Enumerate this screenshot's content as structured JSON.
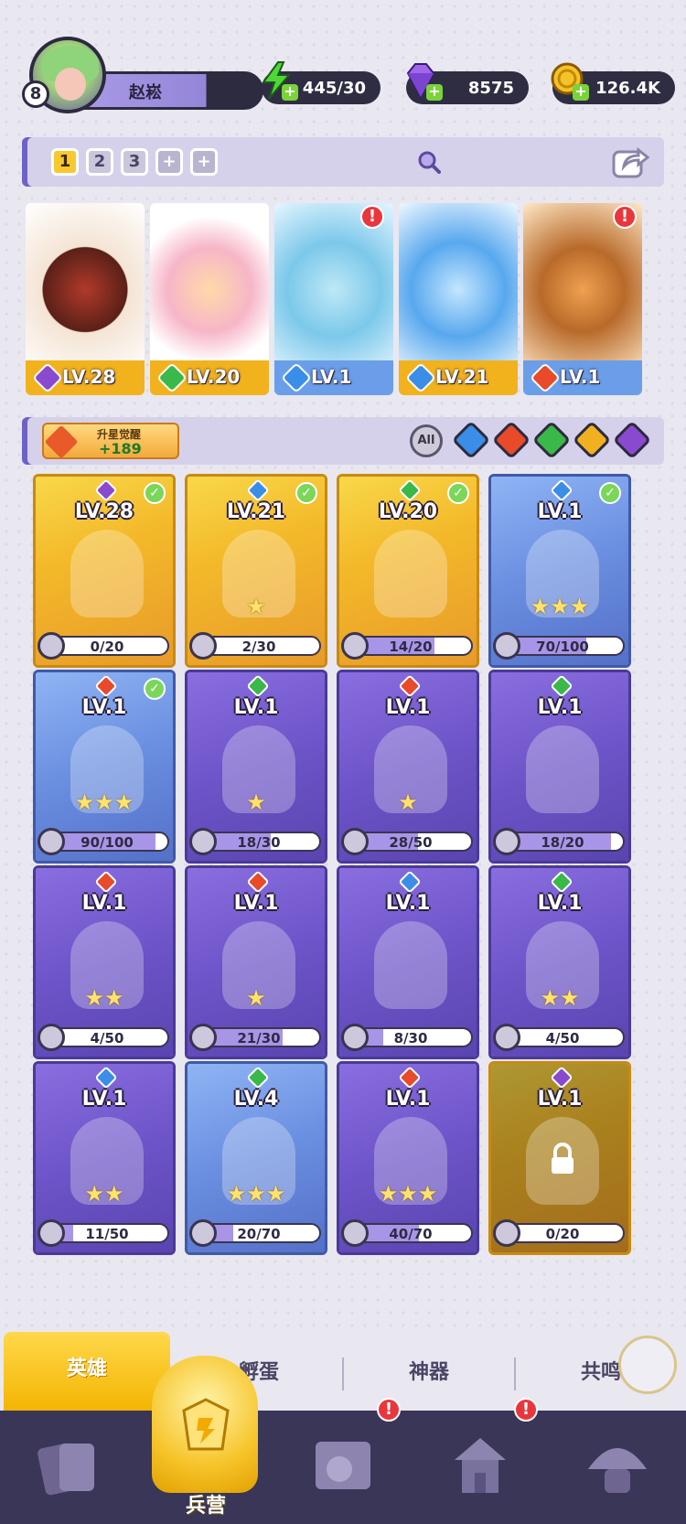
{
  "player": {
    "level": "8",
    "name": "赵崧"
  },
  "resources": [
    {
      "id": "energy",
      "value": "445/30"
    },
    {
      "id": "gems",
      "value": "8575"
    },
    {
      "id": "gold",
      "value": "126.4K"
    }
  ],
  "team": {
    "slots": [
      "1",
      "2",
      "3",
      "+",
      "+"
    ],
    "active_slot": "1",
    "members": [
      {
        "level": "LV.28",
        "element": "dark",
        "alert": false
      },
      {
        "level": "LV.20",
        "element": "wind",
        "alert": false
      },
      {
        "level": "LV.1",
        "element": "water",
        "alert": true
      },
      {
        "level": "LV.21",
        "element": "water",
        "alert": false
      },
      {
        "level": "LV.1",
        "element": "fire",
        "alert": true
      }
    ]
  },
  "upgrade": {
    "label": "升星觉醒",
    "value": "+189"
  },
  "filters": {
    "all_label": "All",
    "elements": [
      "water",
      "fire",
      "wind",
      "light",
      "dark"
    ]
  },
  "heroes": [
    {
      "level": "LV.28",
      "progress": "0/20",
      "frac": 0.0,
      "element": "dark",
      "rarity": "gold",
      "checked": true,
      "stars": 0,
      "locked": false
    },
    {
      "level": "LV.21",
      "progress": "2/30",
      "frac": 0.07,
      "element": "water",
      "rarity": "gold",
      "checked": true,
      "stars": 1,
      "locked": false
    },
    {
      "level": "LV.20",
      "progress": "14/20",
      "frac": 0.7,
      "element": "wind",
      "rarity": "gold",
      "checked": true,
      "stars": 0,
      "locked": false
    },
    {
      "level": "LV.1",
      "progress": "70/100",
      "frac": 0.7,
      "element": "water",
      "rarity": "blue",
      "checked": true,
      "stars": 3,
      "locked": false
    },
    {
      "level": "LV.1",
      "progress": "90/100",
      "frac": 0.9,
      "element": "fire",
      "rarity": "blue",
      "checked": true,
      "stars": 3,
      "locked": false
    },
    {
      "level": "LV.1",
      "progress": "18/30",
      "frac": 0.6,
      "element": "wind",
      "rarity": "purple",
      "checked": false,
      "stars": 1,
      "locked": false
    },
    {
      "level": "LV.1",
      "progress": "28/50",
      "frac": 0.56,
      "element": "fire",
      "rarity": "purple",
      "checked": false,
      "stars": 1,
      "locked": false
    },
    {
      "level": "LV.1",
      "progress": "18/20",
      "frac": 0.9,
      "element": "wind",
      "rarity": "purple",
      "checked": false,
      "stars": 0,
      "locked": false
    },
    {
      "level": "LV.1",
      "progress": "4/50",
      "frac": 0.08,
      "element": "fire",
      "rarity": "purple",
      "checked": false,
      "stars": 2,
      "locked": false
    },
    {
      "level": "LV.1",
      "progress": "21/30",
      "frac": 0.7,
      "element": "fire",
      "rarity": "purple",
      "checked": false,
      "stars": 1,
      "locked": false
    },
    {
      "level": "LV.1",
      "progress": "8/30",
      "frac": 0.27,
      "element": "water",
      "rarity": "purple",
      "checked": false,
      "stars": 0,
      "locked": false
    },
    {
      "level": "LV.1",
      "progress": "4/50",
      "frac": 0.08,
      "element": "wind",
      "rarity": "purple",
      "checked": false,
      "stars": 2,
      "locked": false
    },
    {
      "level": "LV.1",
      "progress": "11/50",
      "frac": 0.22,
      "element": "water",
      "rarity": "purple",
      "checked": false,
      "stars": 2,
      "locked": false
    },
    {
      "level": "LV.4",
      "progress": "20/70",
      "frac": 0.29,
      "element": "wind",
      "rarity": "blue",
      "checked": false,
      "stars": 3,
      "locked": false
    },
    {
      "level": "LV.1",
      "progress": "40/70",
      "frac": 0.57,
      "element": "fire",
      "rarity": "purple",
      "checked": false,
      "stars": 3,
      "locked": false
    },
    {
      "level": "LV.1",
      "progress": "0/20",
      "frac": 0.0,
      "element": "dark",
      "rarity": "gold",
      "checked": false,
      "stars": 0,
      "locked": true
    }
  ],
  "subtabs": [
    "英雄",
    "孵蛋",
    "神器",
    "共鸣"
  ],
  "active_subtab": "英雄",
  "nav": {
    "active_label": "兵营",
    "alerts": [
      false,
      false,
      true,
      true,
      false
    ]
  },
  "colors": {
    "water": "#3a8ee8",
    "fire": "#e84a2a",
    "wind": "#3ab84a",
    "light": "#f0b020",
    "dark": "#8a4ad0",
    "gold": "#f2c23a",
    "purple": "#7a62c8",
    "blue": "#6a8ee0"
  }
}
